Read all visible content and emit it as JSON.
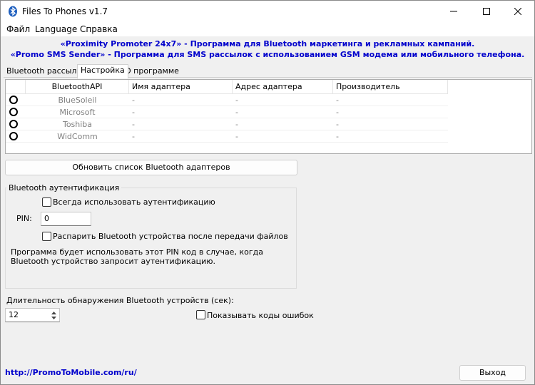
{
  "window": {
    "title": "Files To Phones v1.7"
  },
  "icons": {
    "app": "bluetooth-icon",
    "minimize": "minimize-icon",
    "maximize": "maximize-icon",
    "close": "close-icon"
  },
  "menu": [
    "Файл",
    "Language",
    "Справка"
  ],
  "promo": {
    "line1": "«Proximity Promoter 24x7» - Программа для Bluetooth маркетинга и рекламных кампаний.",
    "line2": "«Promo SMS Sender» - Программа для SMS рассылок с использованием GSM модема или мобильного телефона."
  },
  "tabs": [
    "Bluetooth рассылка",
    "Настройка",
    "О программе"
  ],
  "adapters": {
    "columns": [
      "BluetoothAPI",
      "Имя адаптера",
      "Адрес адаптера",
      "Производитель"
    ],
    "rows": [
      {
        "api": "BlueSoleil",
        "name": "-",
        "address": "-",
        "vendor": "-"
      },
      {
        "api": "Microsoft",
        "name": "-",
        "address": "-",
        "vendor": "-"
      },
      {
        "api": "Toshiba",
        "name": "-",
        "address": "-",
        "vendor": "-"
      },
      {
        "api": "WidComm",
        "name": "-",
        "address": "-",
        "vendor": "-"
      }
    ]
  },
  "refresh_button": "Обновить список Bluetooth адаптеров",
  "auth": {
    "group_title": "Bluetooth аутентификация",
    "always_auth_label": "Всегда использовать аутентификацию",
    "pin_label": "PIN:",
    "pin_value": "0",
    "unpair_label": "Распарить Bluetooth устройства после передачи файлов",
    "info_line1": "Программа будет использовать этот PIN код в случае, когда",
    "info_line2": "Bluetooth устройство запросит аутентификацию."
  },
  "discovery": {
    "label": "Длительность обнаружения Bluetooth устройств (сек):",
    "value": "12",
    "show_errors_label": "Показывать коды ошибок"
  },
  "footer": {
    "link": "http://PromoToMobile.com/ru/",
    "exit_button": "Выход"
  }
}
